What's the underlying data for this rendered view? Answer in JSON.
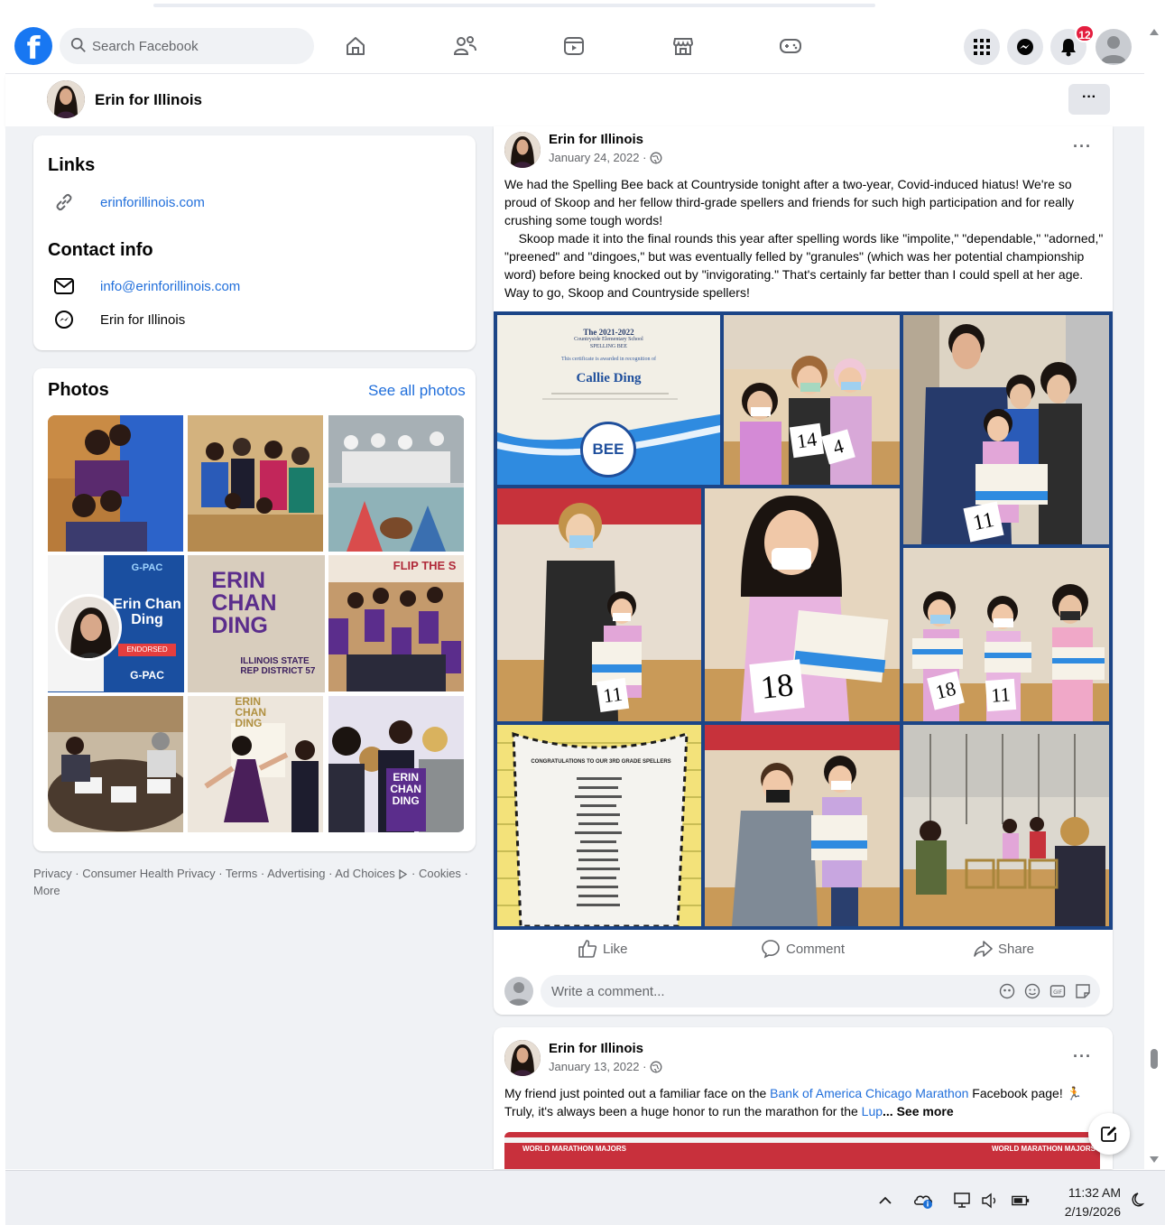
{
  "search": {
    "placeholder": "Search Facebook"
  },
  "notifications": {
    "count": "12"
  },
  "page": {
    "name": "Erin for Illinois",
    "more": "···"
  },
  "links_card": {
    "title": "Links",
    "website": "erinforillinois.com",
    "contact_title": "Contact info",
    "email": "info@erinforillinois.com",
    "messenger": "Erin for Illinois"
  },
  "photos_card": {
    "title": "Photos",
    "see_all": "See all photos"
  },
  "photo_tiles": [
    {
      "name": "photo-couple"
    },
    {
      "name": "photo-group"
    },
    {
      "name": "photo-event"
    },
    {
      "name": "photo-gpac",
      "org": "G-PAC",
      "sub": "ENDORSED",
      "person": "Erin Chan Ding",
      "badge": "G-PAC"
    },
    {
      "name": "photo-sign",
      "text": "ERIN CHAN DING",
      "sub": "ILLINOIS STATE REP DISTRICT 57"
    },
    {
      "name": "photo-volunteers",
      "banner": "FLIP THE S"
    },
    {
      "name": "photo-meeting"
    },
    {
      "name": "photo-dance",
      "text": "ERIN CHAN DING"
    },
    {
      "name": "photo-selfie",
      "text": "ERIN CHAN DING"
    }
  ],
  "footer": {
    "links": [
      "Privacy",
      "Consumer Health Privacy",
      "Terms",
      "Advertising",
      "Ad Choices",
      "Cookies",
      "More"
    ]
  },
  "post1": {
    "author": "Erin for Illinois",
    "date": "January 24, 2022 ·",
    "more": "···",
    "text": "We had the Spelling Bee back at Countryside tonight after a two-year, Covid-induced hiatus! We're so proud of Skoop and her fellow third-grade spellers and friends for such high participation and for really crushing some tough words!\n    Skoop made it into the final rounds this year after spelling words like \"impolite,\" \"dependable,\" \"adorned,\" \"preened\" and \"dingoes,\" but was eventually felled by \"granules\" (which was her potential championship word) before being knocked out by \"invigorating.\" That's certainly far better than I could spell at her age. Way to go, Skoop and Countryside spellers!",
    "certificate": {
      "year": "The 2021-2022",
      "program": "Countryside Elementary School",
      "event": "SPELLING BEE",
      "line": "This certificate is awarded in recognition of",
      "name": "Callie Ding",
      "seal": "BEE"
    },
    "numbers": [
      "14",
      "4",
      "11",
      "11",
      "18",
      "11"
    ],
    "poster_title": "CONGRATULATIONS TO OUR 3RD GRADE SPELLERS",
    "actions": {
      "like": "Like",
      "comment": "Comment",
      "share": "Share"
    },
    "comment_placeholder": "Write a comment..."
  },
  "post2": {
    "author": "Erin for Illinois",
    "date": "January 13, 2022 ·",
    "more": "···",
    "text_a": "My friend just pointed out a familiar face on the ",
    "link_a": "Bank of America Chicago Marathon",
    "text_b": " Facebook page! ",
    "text_c": " Truly, it's always been a huge honor to run the marathon for the ",
    "link_b": "Lup",
    "see_more": "... See more",
    "banner": "WORLD MARATHON MAJORS"
  },
  "taskbar": {
    "time": "11:32 AM",
    "date": "2/19/2026"
  },
  "colors": {
    "brand": "#1877f2",
    "link": "#216fdb",
    "badge": "#e41e3f",
    "gallery_border": "#1c4587"
  }
}
